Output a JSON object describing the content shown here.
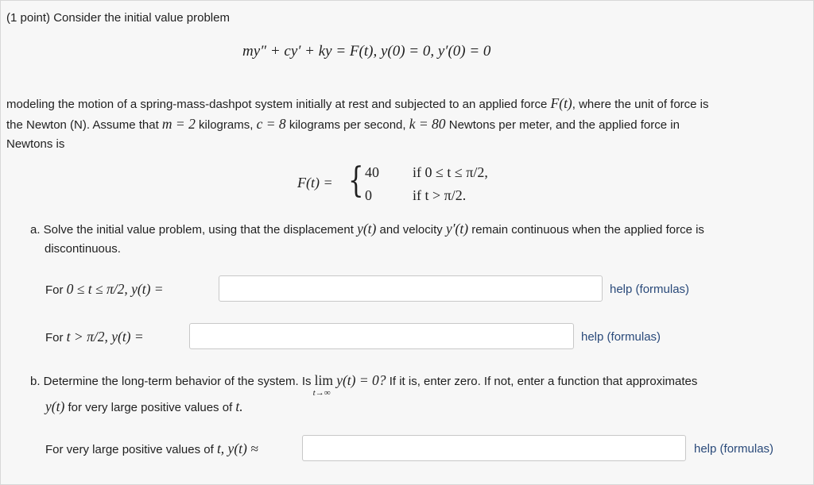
{
  "problem": {
    "intro": "(1 point) Consider the initial value problem",
    "equation": "my″ + cy′ + ky = F(t),   y(0) = 0,   y′(0) = 0",
    "description_line1": "modeling the motion of a spring-mass-dashpot system initially at rest and subjected to an applied force",
    "description_ft": "F(t)",
    "description_line1_end": ", where the unit of force is",
    "description_line2a": "the Newton (N). Assume that",
    "m_expr": "m = 2",
    "description_line2b": "kilograms,",
    "c_expr": "c = 8",
    "description_line2c": "kilograms per second,",
    "k_expr": "k = 80",
    "description_line2d": "Newtons per meter, and the applied force in",
    "description_line3": "Newtons is",
    "piecewise": {
      "lhs": "F(t) =",
      "case1_value": "40",
      "case1_condition": "if 0 ≤ t ≤ π/2,",
      "case2_value": "0",
      "case2_condition": "if t > π/2."
    }
  },
  "part_a": {
    "text_line1_a": "a. Solve the initial value problem, using that the displacement",
    "text_y": "y(t)",
    "text_line1_b": "and velocity",
    "text_yp": "y′(t)",
    "text_line1_c": "remain continuous when the applied force is",
    "text_line2": "discontinuous.",
    "q1_prefix": "For",
    "q1_math": "0 ≤ t ≤ π/2,  y(t) =",
    "q1_value": "",
    "q2_prefix": "For",
    "q2_math": "t > π/2,  y(t) =",
    "q2_value": ""
  },
  "part_b": {
    "text_a": "b. Determine the long-term behavior of the system. Is",
    "lim": "lim",
    "lim_sub": "t→∞",
    "lim_expr": "y(t) = 0?",
    "text_b": "If it is, enter zero. If not, enter a function that approximates",
    "line2_math": "y(t)",
    "line2_text": "for very large positive values of",
    "line2_t": "t.",
    "q3_prefix": "For very large positive values of",
    "q3_math": "t, y(t) ≈",
    "q3_value": ""
  },
  "help_label": "help (formulas)"
}
